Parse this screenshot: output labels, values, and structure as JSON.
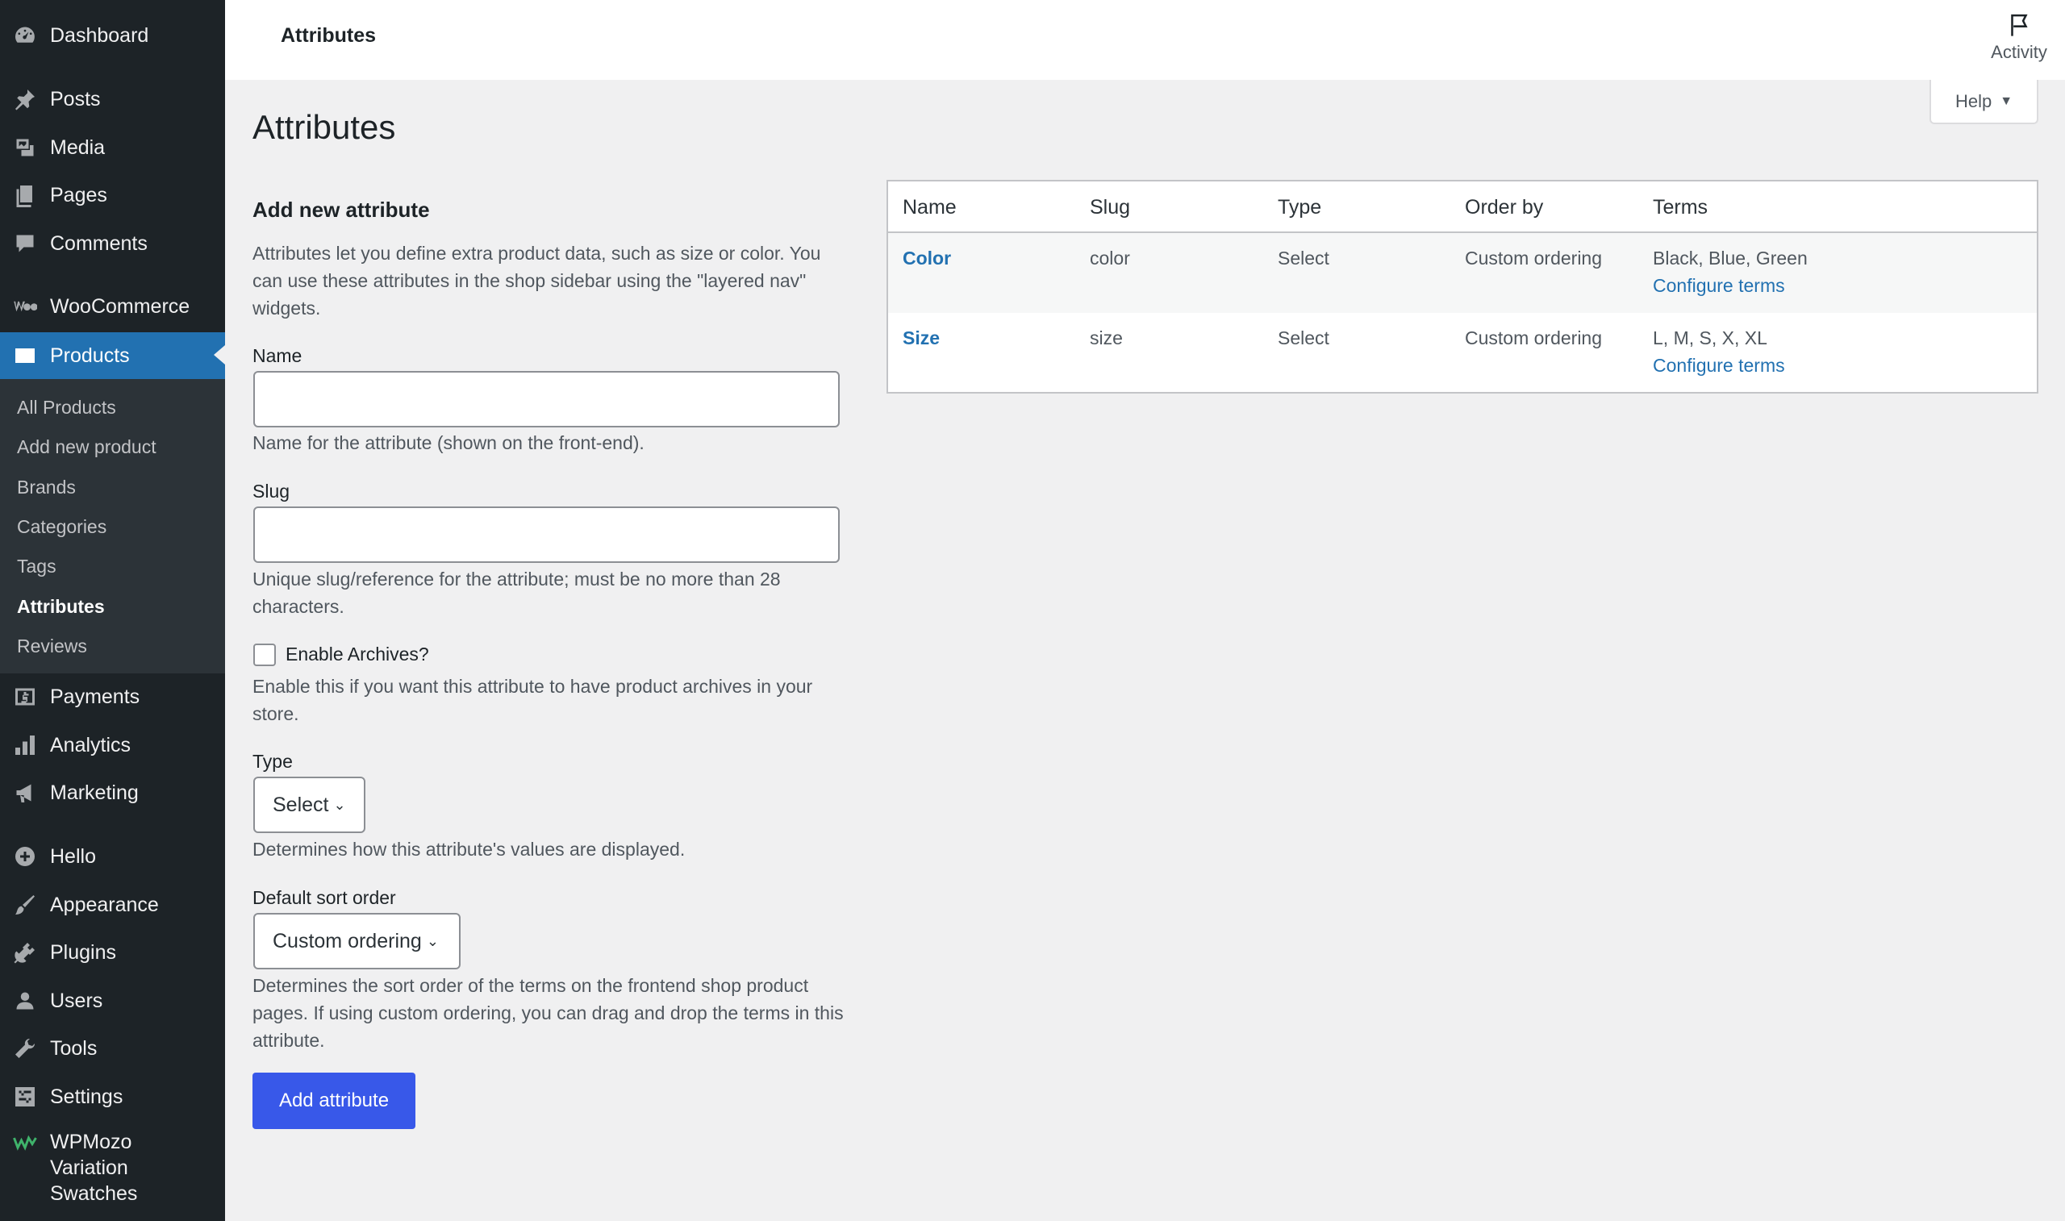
{
  "sidebar": {
    "items": [
      {
        "label": "Dashboard",
        "icon": "dashboard-icon"
      },
      {
        "label": "Posts",
        "icon": "pin-icon"
      },
      {
        "label": "Media",
        "icon": "media-icon"
      },
      {
        "label": "Pages",
        "icon": "pages-icon"
      },
      {
        "label": "Comments",
        "icon": "comment-icon"
      },
      {
        "label": "WooCommerce",
        "icon": "woocommerce-icon"
      },
      {
        "label": "Products",
        "icon": "products-icon"
      },
      {
        "label": "Payments",
        "icon": "payments-icon"
      },
      {
        "label": "Analytics",
        "icon": "analytics-icon"
      },
      {
        "label": "Marketing",
        "icon": "megaphone-icon"
      },
      {
        "label": "Hello",
        "icon": "plus-circle-icon"
      },
      {
        "label": "Appearance",
        "icon": "brush-icon"
      },
      {
        "label": "Plugins",
        "icon": "plug-icon"
      },
      {
        "label": "Users",
        "icon": "user-icon"
      },
      {
        "label": "Tools",
        "icon": "wrench-icon"
      },
      {
        "label": "Settings",
        "icon": "settings-icon"
      }
    ],
    "submenu": [
      "All Products",
      "Add new product",
      "Brands",
      "Categories",
      "Tags",
      "Attributes",
      "Reviews"
    ],
    "plugin": {
      "line1": "WPMozo",
      "line2": "Variation",
      "line3": "Swatches"
    }
  },
  "topbar": {
    "breadcrumb": "Attributes",
    "activity_label": "Activity"
  },
  "help": {
    "label": "Help"
  },
  "page": {
    "title": "Attributes"
  },
  "form": {
    "heading": "Add new attribute",
    "intro": "Attributes let you define extra product data, such as size or color. You can use these attributes in the shop sidebar using the \"layered nav\" widgets.",
    "name_label": "Name",
    "name_help": "Name for the attribute (shown on the front-end).",
    "slug_label": "Slug",
    "slug_help": "Unique slug/reference for the attribute; must be no more than 28 characters.",
    "archives_label": "Enable Archives?",
    "archives_help": "Enable this if you want this attribute to have product archives in your store.",
    "type_label": "Type",
    "type_value": "Select",
    "type_help": "Determines how this attribute's values are displayed.",
    "sort_label": "Default sort order",
    "sort_value": "Custom ordering",
    "sort_help": "Determines the sort order of the terms on the frontend shop product pages. If using custom ordering, you can drag and drop the terms in this attribute.",
    "submit_label": "Add attribute"
  },
  "table": {
    "headers": [
      "Name",
      "Slug",
      "Type",
      "Order by",
      "Terms"
    ],
    "rows": [
      {
        "name": "Color",
        "slug": "color",
        "type": "Select",
        "order": "Custom ordering",
        "terms": "Black, Blue, Green",
        "configure": "Configure terms"
      },
      {
        "name": "Size",
        "slug": "size",
        "type": "Select",
        "order": "Custom ordering",
        "terms": "L, M, S, X, XL",
        "configure": "Configure terms"
      }
    ]
  }
}
